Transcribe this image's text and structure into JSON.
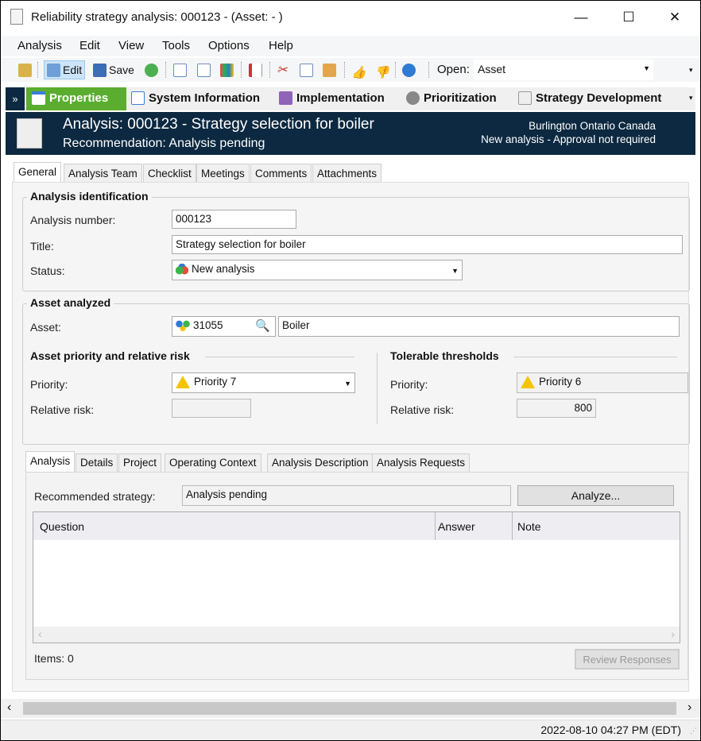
{
  "window": {
    "title": "Reliability strategy analysis: 000123 -  (Asset:  - )",
    "minimize": "—",
    "maximize": "☐",
    "close": "✕"
  },
  "menu": [
    "Analysis",
    "Edit",
    "View",
    "Tools",
    "Options",
    "Help"
  ],
  "toolbar": {
    "edit": "Edit",
    "save": "Save",
    "open_label": "Open:",
    "open_value": "Asset"
  },
  "nav": [
    "Properties",
    "System Information",
    "Implementation",
    "Prioritization",
    "Strategy Development"
  ],
  "header": {
    "title": "Analysis: 000123 - Strategy selection for boiler",
    "subtitle": "Recommendation: Analysis pending",
    "location": "Burlington Ontario Canada",
    "approval": "New analysis - Approval not required"
  },
  "tabs": [
    "General",
    "Analysis Team",
    "Checklist",
    "Meetings",
    "Comments",
    "Attachments"
  ],
  "identification": {
    "heading": "Analysis identification",
    "number_label": "Analysis number:",
    "number": "000123",
    "title_label": "Title:",
    "title": "Strategy selection for boiler",
    "status_label": "Status:",
    "status": "New analysis"
  },
  "asset": {
    "heading": "Asset analyzed",
    "asset_label": "Asset:",
    "asset_id": "31055",
    "asset_name": "Boiler"
  },
  "priority": {
    "heading": "Asset priority and relative risk",
    "priority_label": "Priority:",
    "priority": "Priority 7",
    "risk_label": "Relative risk:",
    "risk": ""
  },
  "tolerable": {
    "heading": "Tolerable thresholds",
    "priority_label": "Priority:",
    "priority": "Priority 6",
    "risk_label": "Relative risk:",
    "risk": "800"
  },
  "subtabs": [
    "Analysis",
    "Details",
    "Project",
    "Operating Context",
    "Analysis Description",
    "Analysis Requests"
  ],
  "analysis": {
    "strategy_label": "Recommended strategy:",
    "strategy": "Analysis pending",
    "analyze": "Analyze...",
    "columns": [
      "Question",
      "Answer",
      "Note"
    ],
    "items": "Items: 0",
    "review": "Review Responses"
  },
  "status_bar": {
    "datetime": "2022-08-10 04:27 PM (EDT)"
  }
}
